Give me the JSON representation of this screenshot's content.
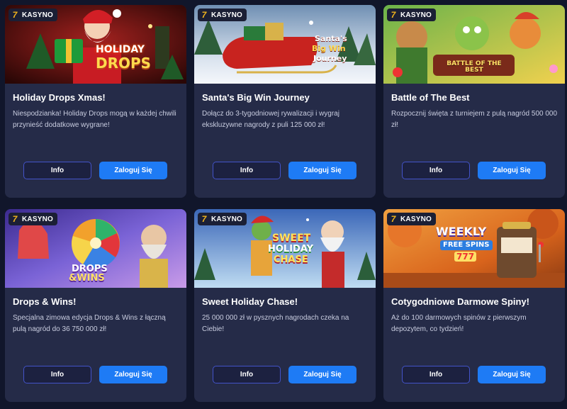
{
  "badge": {
    "icon": "seven-logo-icon",
    "label": "KASYNO"
  },
  "buttons": {
    "info": "Info",
    "login": "Zaloguj Się"
  },
  "colors": {
    "page_bg": "#11162b",
    "card_bg": "#252b48",
    "accent": "#1e7bf5",
    "info_border": "#4353c9"
  },
  "cards": [
    {
      "banner_text": [
        "HOLIDAY",
        "DROPS"
      ],
      "title": "Holiday Drops Xmas!",
      "description": "Niespodzianka! Holiday Drops mogą w każdej chwili przynieść dodatkowe wygrane!"
    },
    {
      "banner_text": [
        "Santa's",
        "Big Win",
        "Journey"
      ],
      "title": "Santa's Big Win Journey",
      "description": "Dołącz do 3-tygodniowej rywalizacji i wygraj ekskluzywne nagrody z puli 125 000 zł!"
    },
    {
      "banner_text": [
        "BATTLE OF THE BEST"
      ],
      "title": "Battle of The Best",
      "description": "Rozpocznij święta z turniejem z pulą nagród 500 000 zł!"
    },
    {
      "banner_text": [
        "DROPS",
        "&WINS"
      ],
      "title": "Drops & Wins!",
      "description": "Specjalna zimowa edycja Drops & Wins z łączną pulą nagród do 36 750 000 zł!"
    },
    {
      "banner_text": [
        "SWEET",
        "HOLIDAY",
        "CHASE"
      ],
      "title": "Sweet Holiday Chase!",
      "description": "25 000 000 zł w pysznych nagrodach czeka na Ciebie!"
    },
    {
      "banner_text": [
        "WEEKLY",
        "FREE SPINS",
        "777"
      ],
      "title": "Cotygodniowe Darmowe Spiny!",
      "description": "Aż do 100 darmowych spinów z pierwszym depozytem, co tydzień!"
    }
  ]
}
